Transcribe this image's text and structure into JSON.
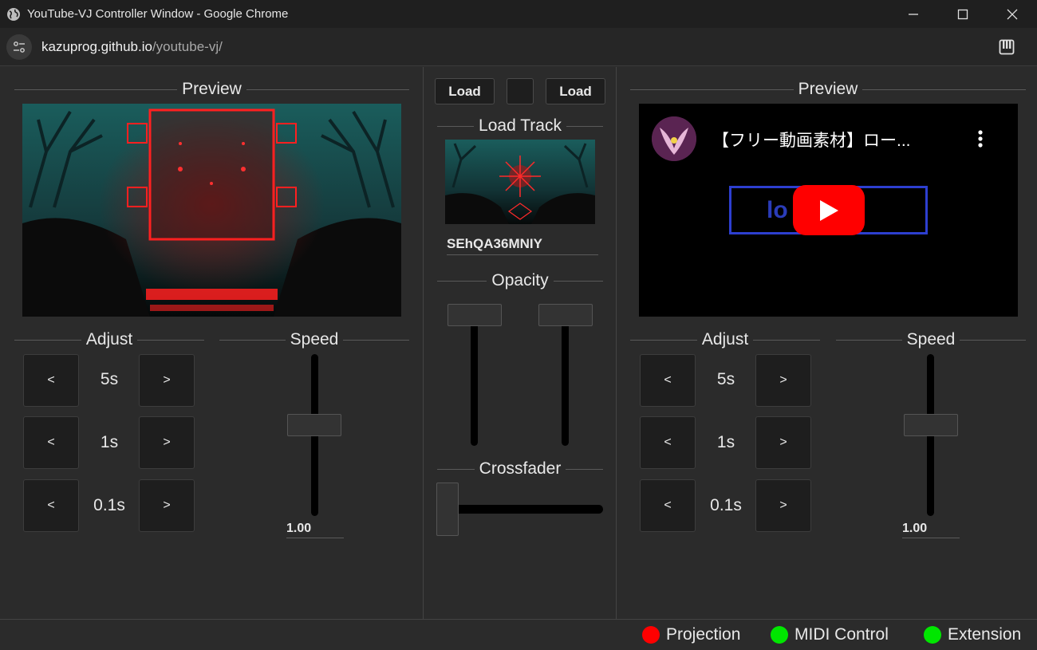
{
  "window": {
    "title": "YouTube-VJ Controller Window - Google Chrome"
  },
  "address": {
    "host": "kazuprog.github.io",
    "path": "/youtube-vj/"
  },
  "left_deck": {
    "preview_title": "Preview",
    "adjust_title": "Adjust",
    "speed_title": "Speed",
    "seek_rows": [
      {
        "back": "<",
        "label": "5s",
        "forward": ">"
      },
      {
        "back": "<",
        "label": "1s",
        "forward": ">"
      },
      {
        "back": "<",
        "label": "0.1s",
        "forward": ">"
      }
    ],
    "speed_value": "1.00"
  },
  "center": {
    "load_left": "Load",
    "load_right": "Load",
    "load_track_title": "Load Track",
    "track_id": "SEhQA36MNIY",
    "opacity_title": "Opacity",
    "crossfader_title": "Crossfader"
  },
  "right_deck": {
    "preview_title": "Preview",
    "video_title": "【フリー動画素材】ロー...",
    "logo_text": "lo          ...",
    "adjust_title": "Adjust",
    "speed_title": "Speed",
    "seek_rows": [
      {
        "back": "<",
        "label": "5s",
        "forward": ">"
      },
      {
        "back": "<",
        "label": "1s",
        "forward": ">"
      },
      {
        "back": "<",
        "label": "0.1s",
        "forward": ">"
      }
    ],
    "speed_value": "1.00"
  },
  "status": {
    "projection": "Projection",
    "midi": "MIDI Control",
    "extension": "Extension",
    "colors": {
      "projection": "#ff0000",
      "midi": "#00e600",
      "extension": "#00e600"
    }
  }
}
